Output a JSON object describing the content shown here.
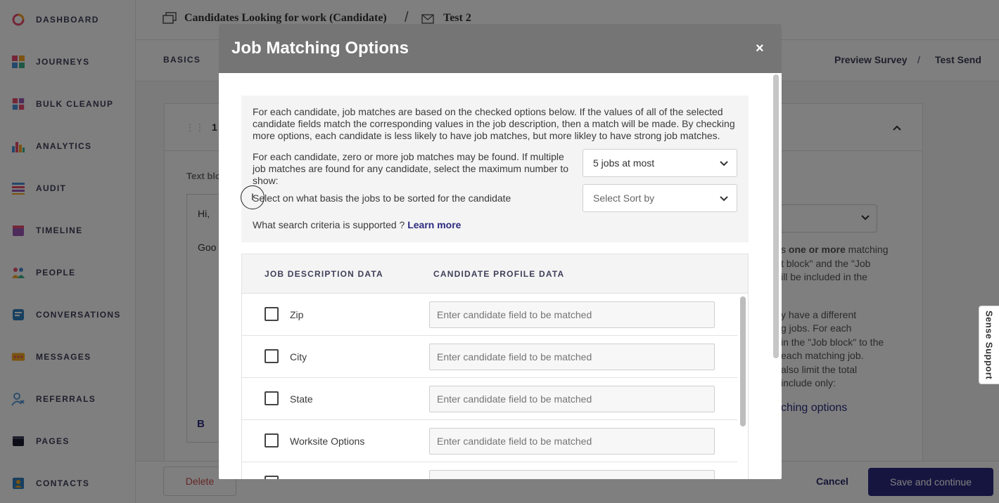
{
  "colors": {
    "accent": "#2c2a80",
    "modal_header": "#757575",
    "delete": "#c94a4a"
  },
  "sidebar": {
    "items": [
      {
        "label": "DASHBOARD",
        "icon": "dashboard-icon"
      },
      {
        "label": "JOURNEYS",
        "icon": "journeys-icon"
      },
      {
        "label": "BULK CLEANUP",
        "icon": "bulk-cleanup-icon"
      },
      {
        "label": "ANALYTICS",
        "icon": "analytics-icon"
      },
      {
        "label": "AUDIT",
        "icon": "audit-icon"
      },
      {
        "label": "TIMELINE",
        "icon": "timeline-icon"
      },
      {
        "label": "PEOPLE",
        "icon": "people-icon"
      },
      {
        "label": "CONVERSATIONS",
        "icon": "conversations-icon"
      },
      {
        "label": "MESSAGES",
        "icon": "messages-icon"
      },
      {
        "label": "REFERRALS",
        "icon": "referrals-icon"
      },
      {
        "label": "PAGES",
        "icon": "pages-icon"
      },
      {
        "label": "CONTACTS",
        "icon": "contacts-icon"
      }
    ]
  },
  "breadcrumb": {
    "journey": "Candidates Looking for work (Candidate)",
    "separator": "/",
    "message": "Test 2"
  },
  "subnav": {
    "basics": "BASICS",
    "preview": "Preview Survey",
    "separator": "/",
    "test_send": "Test Send"
  },
  "background": {
    "step_number": "1",
    "text_block_label": "Text blo",
    "editor_line1": "Hi,",
    "editor_line2": "Goo",
    "bold_button": "B",
    "right_lines": [
      {
        "pre": "s ",
        "bold": "one or more",
        "post": " matching"
      },
      {
        "pre": "t block\" and the \"Job",
        "bold": "",
        "post": ""
      },
      {
        "pre": "ill be included in the",
        "bold": "",
        "post": ""
      },
      {
        "pre": "y have a different",
        "bold": "",
        "post": ""
      },
      {
        "pre": "g jobs. For each",
        "bold": "",
        "post": ""
      },
      {
        "pre": "in the \"Job block\" to the",
        "bold": "",
        "post": ""
      },
      {
        "pre": "each matching job.",
        "bold": "",
        "post": ""
      },
      {
        "pre": "also limit the total",
        "bold": "",
        "post": ""
      },
      {
        "pre": "include only:",
        "bold": "",
        "post": ""
      }
    ],
    "matching_options_link": "ching options"
  },
  "footer": {
    "delete": "Delete",
    "cancel": "Cancel",
    "save": "Save and continue"
  },
  "support_tab": "Sense Support",
  "modal": {
    "title": "Job Matching Options",
    "close": "×",
    "intro": "For each candidate, job matches are based on the checked options below. If the values of all of the selected candidate fields match the corresponding values in the job description, then a match will be made. By checking more options, each candidate is less likely to have job matches, but more likley to have strong job matches.",
    "max_label": "For each candidate, zero or more job matches may be found. If multiple job matches are found for any candidate, select the maximum number to show:",
    "max_value": "5 jobs at most",
    "sort_label": "Select on what basis the jobs to be sorted for the candidate",
    "sort_placeholder": "Select Sort by",
    "criteria_text": "What search criteria is supported ?",
    "learn_more": "Learn more",
    "table": {
      "col_job": "JOB DESCRIPTION DATA",
      "col_candidate": "CANDIDATE PROFILE DATA",
      "input_placeholder": "Enter candidate field to be matched",
      "rows": [
        {
          "label": "Zip"
        },
        {
          "label": "City"
        },
        {
          "label": "State"
        },
        {
          "label": "Worksite Options"
        },
        {
          "label": ""
        }
      ]
    }
  }
}
